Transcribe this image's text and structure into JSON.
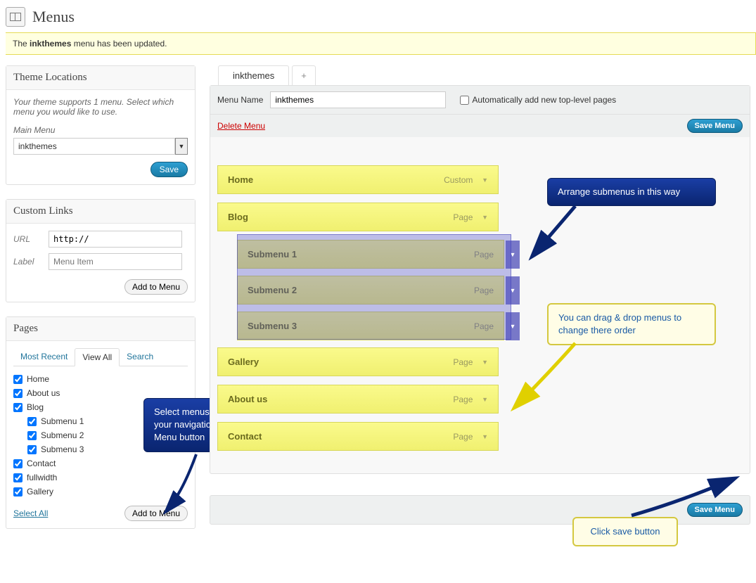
{
  "page": {
    "title": "Menus"
  },
  "notice": {
    "prefix": "The ",
    "bold": "inkthemes",
    "suffix": " menu has been updated."
  },
  "theme_locations": {
    "title": "Theme Locations",
    "desc": "Your theme supports 1 menu. Select which menu you would like to use.",
    "main_label": "Main Menu",
    "selected": "inkthemes",
    "save": "Save"
  },
  "custom_links": {
    "title": "Custom Links",
    "url_label": "URL",
    "url_value": "http://",
    "label_label": "Label",
    "label_placeholder": "Menu Item",
    "add_btn": "Add to Menu"
  },
  "pages": {
    "title": "Pages",
    "tabs": [
      "Most Recent",
      "View All",
      "Search"
    ],
    "active_tab": 1,
    "items": [
      {
        "label": "Home",
        "checked": true,
        "indent": false
      },
      {
        "label": "About us",
        "checked": true,
        "indent": false
      },
      {
        "label": "Blog",
        "checked": true,
        "indent": false
      },
      {
        "label": "Submenu 1",
        "checked": true,
        "indent": true
      },
      {
        "label": "Submenu 2",
        "checked": true,
        "indent": true
      },
      {
        "label": "Submenu 3",
        "checked": true,
        "indent": true
      },
      {
        "label": "Contact",
        "checked": true,
        "indent": false
      },
      {
        "label": "fullwidth",
        "checked": true,
        "indent": false
      },
      {
        "label": "Gallery",
        "checked": true,
        "indent": false
      }
    ],
    "select_all": "Select All",
    "add_btn": "Add to Menu"
  },
  "menu_editor": {
    "tabs": [
      "inkthemes",
      "+"
    ],
    "menu_name_label": "Menu Name",
    "menu_name_value": "inkthemes",
    "auto_add_label": "Automatically add new top-level pages",
    "delete": "Delete Menu",
    "save": "Save Menu",
    "items": [
      {
        "label": "Home",
        "type": "Custom",
        "sub": false
      },
      {
        "label": "Blog",
        "type": "Page",
        "sub": false
      },
      {
        "label": "Submenu 1",
        "type": "Page",
        "sub": true
      },
      {
        "label": "Submenu 2",
        "type": "Page",
        "sub": true
      },
      {
        "label": "Submenu 3",
        "type": "Page",
        "sub": true
      },
      {
        "label": "Gallery",
        "type": "Page",
        "sub": false
      },
      {
        "label": "About us",
        "type": "Page",
        "sub": false
      },
      {
        "label": "Contact",
        "type": "Page",
        "sub": false
      }
    ]
  },
  "callouts": {
    "c1": "Arrange submenus in this way",
    "c2": "You can drag & drop menus to change there order",
    "c3": "Select menus that you want at your navigation bar & click Add to Menu button",
    "c4": "Click save button"
  }
}
